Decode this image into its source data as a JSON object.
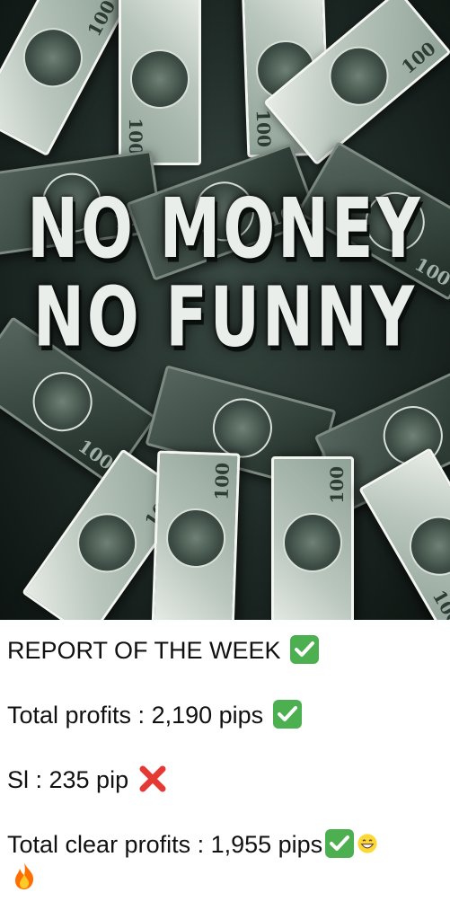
{
  "image": {
    "headline_line1": "NO MONEY",
    "headline_line2": "NO FUNNY"
  },
  "report": {
    "line1": "REPORT OF THE WEEK",
    "line2": "Total profits : 2,190 pips",
    "line3": "Sl : 235 pip",
    "line4": "Total clear profits : 1,955 pips"
  },
  "icons": {
    "check": "check-mark-emoji",
    "cross": "cross-mark-emoji",
    "grin": "grinning-face-emoji",
    "fire": "fire-emoji"
  },
  "colors": {
    "check_bg": "#4caf50",
    "cross": "#e53935",
    "text": "#111111"
  }
}
